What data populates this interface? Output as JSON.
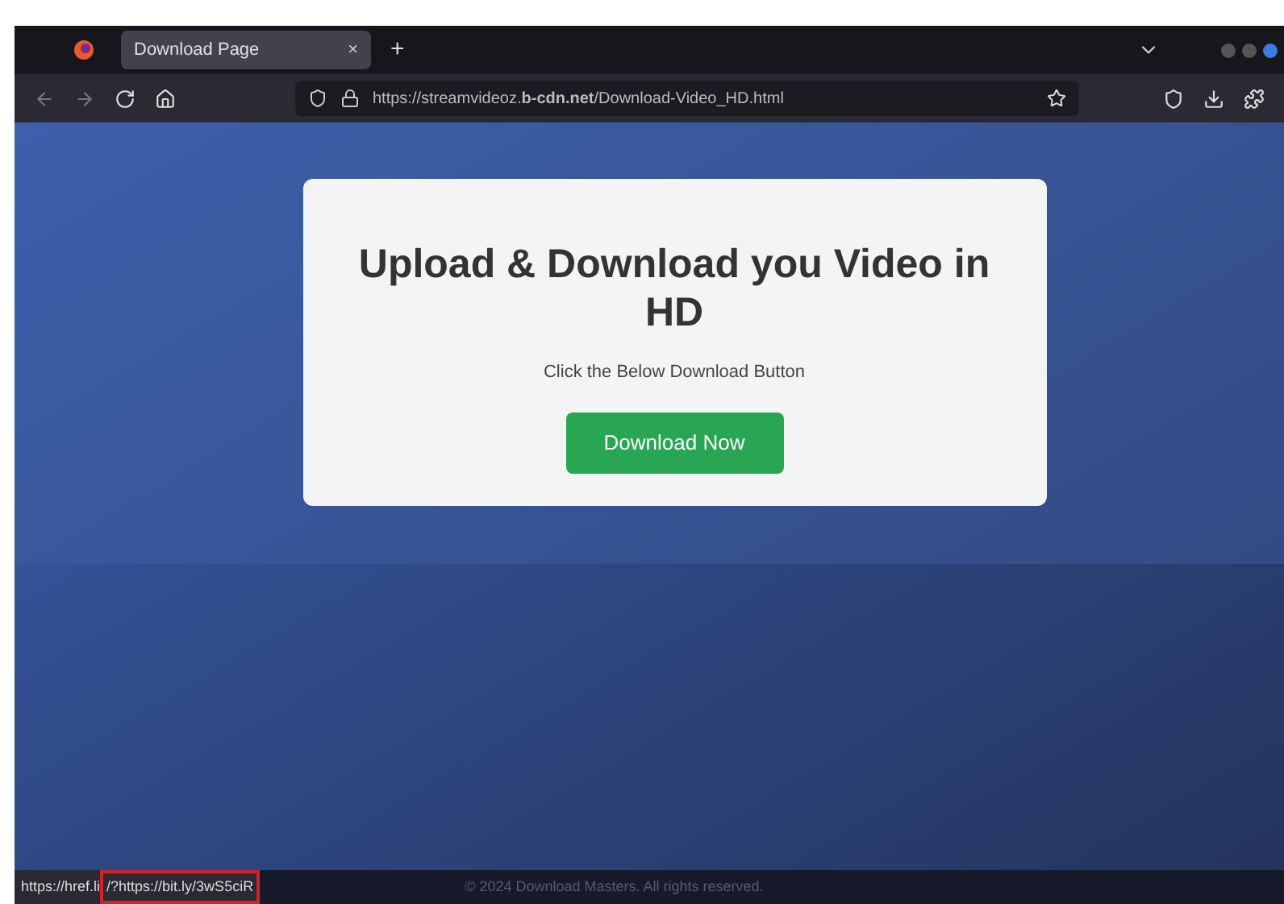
{
  "tabs": [
    {
      "label": "Download Page",
      "selected": true,
      "close": "×"
    }
  ],
  "new_tab": "+",
  "address_bar": {
    "url": "https://streamvideoz.**b-cdn.net**/Download-Video_HD.html"
  },
  "card": {
    "heading": "Upload & Download you Video in HD",
    "subtitle": "Click the Below Download Button",
    "button": "Download Now"
  },
  "status_bar": {
    "link": "https://href.li",
    "highlighted": "/?https://bit.ly/3wS5ciR"
  },
  "footer": "© 2024 Download Masters. All rights reserved."
}
